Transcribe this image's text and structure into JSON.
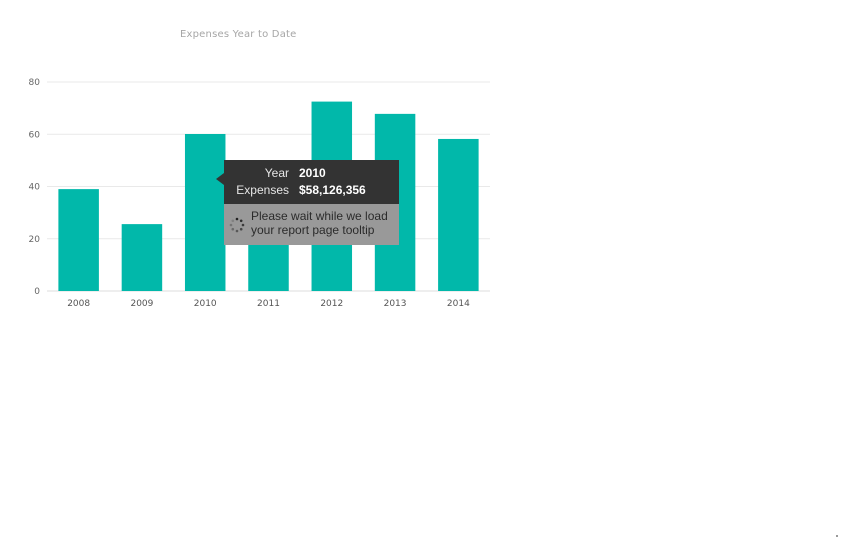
{
  "chart_data": {
    "type": "bar",
    "title": "Expenses Year to Date",
    "categories": [
      "2008",
      "2009",
      "2010",
      "2011",
      "2012",
      "2013",
      "2014"
    ],
    "values": [
      39,
      25.6,
      60.1,
      38,
      72.5,
      67.8,
      58.2
    ],
    "ylim": [
      0,
      80
    ],
    "yticks": [
      0,
      20,
      40,
      60,
      80
    ],
    "ytick_labels": [
      "0",
      "20",
      "40",
      "60",
      "80"
    ],
    "grid": true,
    "bar_color": "#01b8aa",
    "grid_color": "#e9e9e9"
  },
  "tooltip": {
    "year_label": "Year",
    "year_value": "2010",
    "expenses_label": "Expenses",
    "expenses_value": "$58,126,356",
    "loading_line1": "Please wait while we load",
    "loading_line2": "your report page tooltip"
  },
  "icons": {
    "loading": "spinner-icon"
  }
}
